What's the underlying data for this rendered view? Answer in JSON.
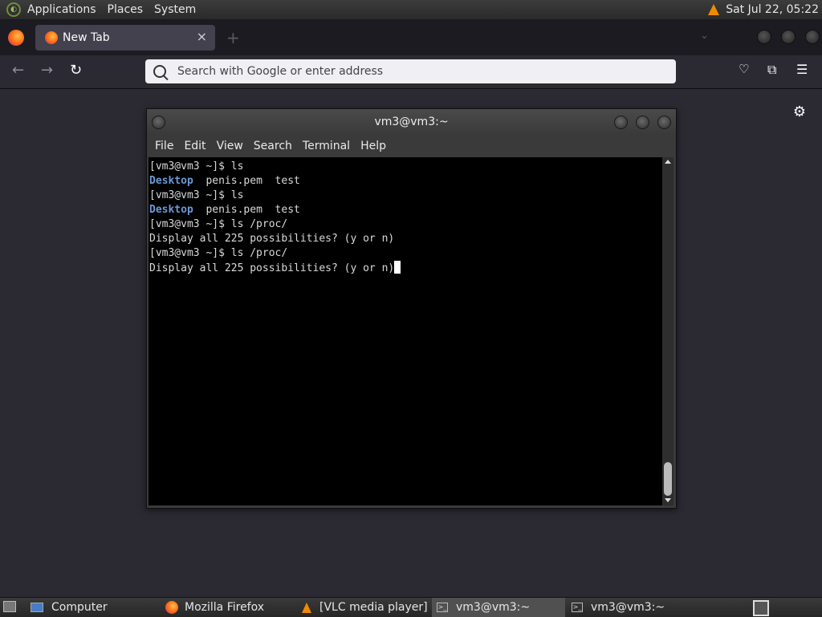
{
  "top_panel": {
    "menus": [
      "Applications",
      "Places",
      "System"
    ],
    "clock": "Sat Jul 22, 05:22"
  },
  "browser": {
    "tab_title": "New Tab",
    "tab_close": "×",
    "new_tab": "+",
    "back": "←",
    "forward": "→",
    "reload": "↻",
    "url_placeholder": "Search with Google or enter address",
    "url_value": ""
  },
  "terminal": {
    "title": "vm3@vm3:~",
    "menus": [
      "File",
      "Edit",
      "View",
      "Search",
      "Terminal",
      "Help"
    ],
    "lines": [
      "[vm3@vm3 ~]$ ls",
      "Desktop  penis.pem  test",
      "[vm3@vm3 ~]$ ls",
      "Desktop  penis.pem  test",
      "[vm3@vm3 ~]$ ls /proc/",
      "Display all 225 possibilities? (y or n)",
      "[vm3@vm3 ~]$ ls /proc/",
      "Display all 225 possibilities? (y or n)"
    ],
    "dir_name": "Desktop",
    "dir_rest": "  penis.pem  test"
  },
  "taskbar": {
    "items": [
      {
        "label": "Computer",
        "icon": "computer-icon"
      },
      {
        "label": "Mozilla Firefox",
        "icon": "firefox-icon"
      },
      {
        "label": "[VLC media player]",
        "icon": "vlc-icon"
      },
      {
        "label": "vm3@vm3:~",
        "icon": "terminal-icon",
        "active": true
      },
      {
        "label": "vm3@vm3:~",
        "icon": "terminal-icon"
      }
    ]
  }
}
